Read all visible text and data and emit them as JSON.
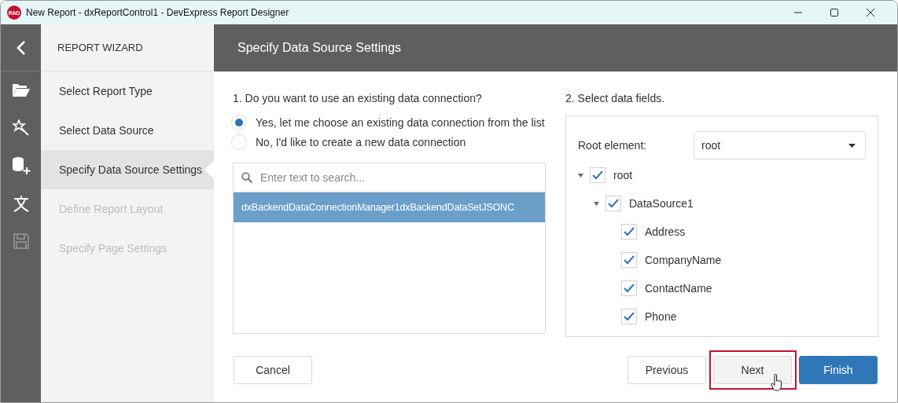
{
  "window": {
    "title": "New Report - dxReportControl1 - DevExpress Report Designer",
    "app_badge": "RAD"
  },
  "wizard": {
    "title": "REPORT WIZARD",
    "steps": [
      {
        "label": "Select Report Type",
        "selected": false,
        "disabled": false
      },
      {
        "label": "Select Data Source",
        "selected": false,
        "disabled": false
      },
      {
        "label": "Specify Data Source Settings",
        "selected": true,
        "disabled": false
      },
      {
        "label": "Define Report Layout",
        "selected": false,
        "disabled": true
      },
      {
        "label": "Specify Page Settings",
        "selected": false,
        "disabled": true
      }
    ]
  },
  "header": {
    "title": "Specify Data Source Settings"
  },
  "connection": {
    "question": "1. Do you want to use an existing data connection?",
    "options": [
      {
        "label": "Yes, let me choose an existing data connection from the list",
        "selected": true
      },
      {
        "label": "No, I'd like to create a new data connection",
        "selected": false
      }
    ],
    "search": {
      "placeholder": "Enter text to search..."
    },
    "items": [
      {
        "label": "dxBackendDataConnectionManager1dxBackendDataSetJSONC",
        "selected": true
      }
    ]
  },
  "fields": {
    "title": "2. Select data fields.",
    "root_label": "Root element:",
    "root_value": "root",
    "tree": [
      {
        "label": "root",
        "checked": true,
        "expanded": true,
        "children": [
          {
            "label": "DataSource1",
            "checked": true,
            "expanded": true,
            "children": [
              {
                "label": "Address",
                "checked": true
              },
              {
                "label": "CompanyName",
                "checked": true
              },
              {
                "label": "ContactName",
                "checked": true
              },
              {
                "label": "Phone",
                "checked": true
              }
            ]
          }
        ]
      }
    ]
  },
  "buttons": [
    {
      "label": "Cancel",
      "kind": "plain",
      "highlighted": false
    },
    {
      "label": "Previous",
      "kind": "plain",
      "highlighted": false
    },
    {
      "label": "Next",
      "kind": "hover",
      "highlighted": true
    },
    {
      "label": "Finish",
      "kind": "primary",
      "highlighted": false
    }
  ]
}
